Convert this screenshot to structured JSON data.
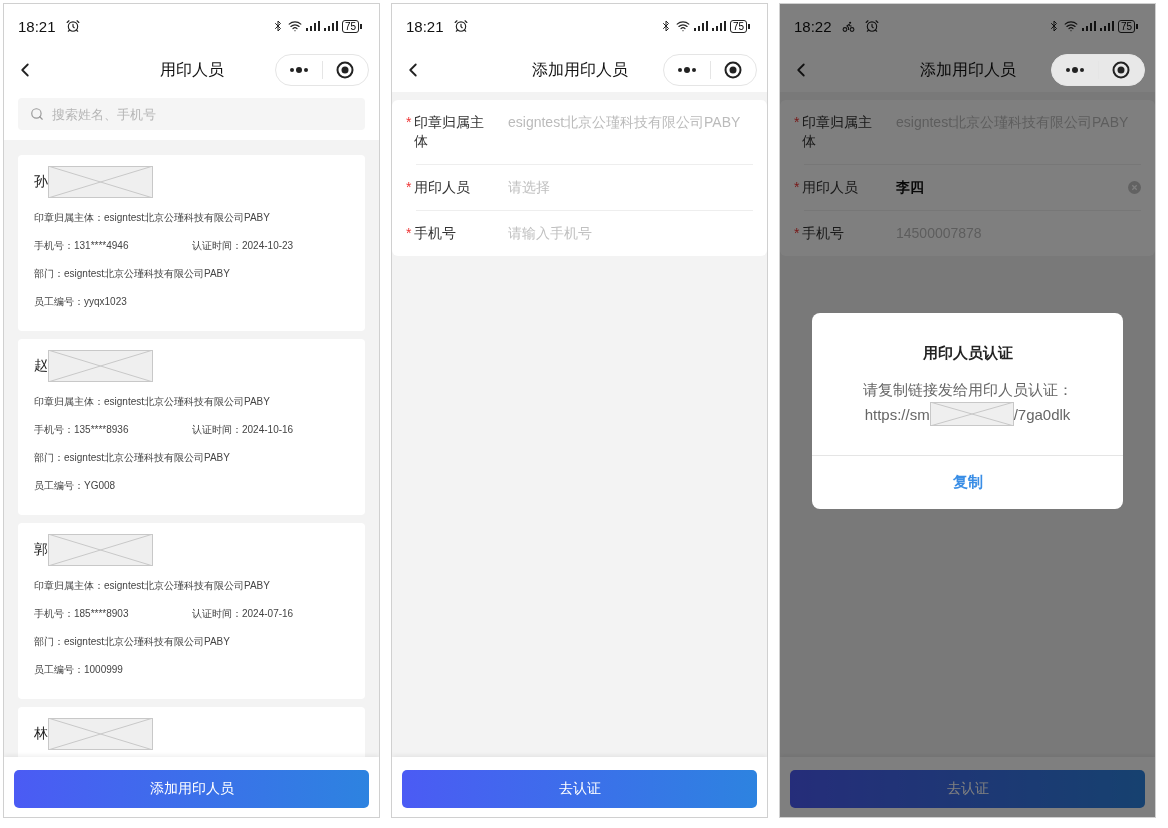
{
  "screens": [
    {
      "kind": "list",
      "status": {
        "time": "18:21",
        "battery": "75",
        "extra_icon": false
      },
      "title": "用印人员",
      "overlay": false,
      "search": {
        "placeholder": "搜索姓名、手机号"
      },
      "people": [
        {
          "surname": "孙",
          "entity": "印章归属主体：esigntest北京公瑾科技有限公司PABY",
          "phone": "手机号：131****4946",
          "certified": "认证时间：2024-10-23",
          "dept": "部门：esigntest北京公瑾科技有限公司PABY",
          "employee_no": "员工编号：yyqx1023"
        },
        {
          "surname": "赵",
          "entity": "印章归属主体：esigntest北京公瑾科技有限公司PABY",
          "phone": "手机号：135****8936",
          "certified": "认证时间：2024-10-16",
          "dept": "部门：esigntest北京公瑾科技有限公司PABY",
          "employee_no": "员工编号：YG008"
        },
        {
          "surname": "郭",
          "entity": "印章归属主体：esigntest北京公瑾科技有限公司PABY",
          "phone": "手机号：185****8903",
          "certified": "认证时间：2024-07-16",
          "dept": "部门：esigntest北京公瑾科技有限公司PABY",
          "employee_no": "员工编号：1000999"
        },
        {
          "surname": "林"
        }
      ],
      "button": "添加用印人员"
    },
    {
      "kind": "form",
      "status": {
        "time": "18:21",
        "battery": "75",
        "extra_icon": false
      },
      "title": "添加用印人员",
      "overlay": false,
      "fields": [
        {
          "label": "印章归属主体",
          "required_mark": "*",
          "value": "esigntest北京公瑾科技有限公司PABY",
          "disabled": true,
          "clearable": false
        },
        {
          "label": "用印人员",
          "required_mark": "*",
          "placeholder": "请选择",
          "clearable": false
        },
        {
          "label": "手机号",
          "required_mark": "*",
          "placeholder": "请输入手机号",
          "clearable": false
        }
      ],
      "button": "去认证"
    },
    {
      "kind": "form",
      "status": {
        "time": "18:22",
        "battery": "75",
        "extra_icon": true
      },
      "title": "添加用印人员",
      "overlay": true,
      "fields": [
        {
          "label": "印章归属主体",
          "required_mark": "*",
          "value": "esigntest北京公瑾科技有限公司PABY",
          "disabled": true,
          "clearable": false
        },
        {
          "label": "用印人员",
          "required_mark": "*",
          "value": "李四",
          "disabled": false,
          "clearable": true
        },
        {
          "label": "手机号",
          "required_mark": "*",
          "value": "14500007878",
          "disabled": true,
          "clearable": false
        }
      ],
      "button": "去认证",
      "dialog": {
        "title": "用印人员认证",
        "message": "请复制链接发给用印人员认证：",
        "link_start": "https://sm",
        "link_end": "/7ga0dlk",
        "action": "复制"
      }
    }
  ]
}
